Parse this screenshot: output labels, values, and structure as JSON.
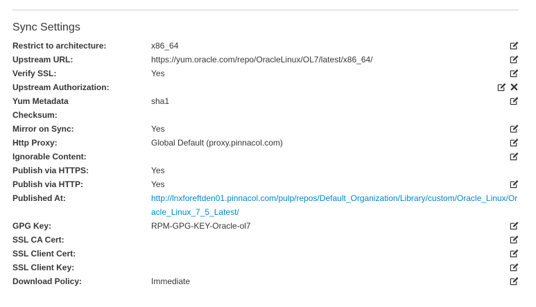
{
  "section": {
    "title": "Sync Settings"
  },
  "settings": [
    {
      "label": "Restrict to architecture:",
      "value": "x86_64",
      "edit": true,
      "clear": false
    },
    {
      "label": "Upstream URL:",
      "value": "https://yum.oracle.com/repo/OracleLinux/OL7/latest/x86_64/",
      "edit": true,
      "clear": false
    },
    {
      "label": "Verify SSL:",
      "value": "Yes",
      "edit": true,
      "clear": false
    },
    {
      "label": "Upstream Authorization:",
      "value": "",
      "edit": true,
      "clear": true
    },
    {
      "label": "Yum Metadata",
      "value": "sha1",
      "edit": true,
      "clear": false
    },
    {
      "label": "Checksum:",
      "value": "",
      "edit": false,
      "clear": false
    },
    {
      "label": "Mirror on Sync:",
      "value": "Yes",
      "edit": true,
      "clear": false
    },
    {
      "label": "Http Proxy:",
      "value": "Global Default (proxy.pinnacol.com)",
      "edit": true,
      "clear": false
    },
    {
      "label": "Ignorable Content:",
      "value": "",
      "edit": true,
      "clear": false
    },
    {
      "label": "Publish via HTTPS:",
      "value": "Yes",
      "edit": false,
      "clear": false
    },
    {
      "label": "Publish via HTTP:",
      "value": "Yes",
      "edit": true,
      "clear": false
    },
    {
      "label": "Published At:",
      "value": "http://lnxforeftden01.pinnacol.com/pulp/repos/Default_Organization/Library/custom/Oracle_Linux/Oracle_Linux_7_5_Latest/",
      "edit": false,
      "clear": false,
      "link": true
    },
    {
      "label": "GPG Key:",
      "value": "RPM-GPG-KEY-Oracle-ol7",
      "edit": true,
      "clear": false
    },
    {
      "label": "SSL CA Cert:",
      "value": "",
      "edit": true,
      "clear": false
    },
    {
      "label": "SSL Client Cert:",
      "value": "",
      "edit": true,
      "clear": false
    },
    {
      "label": "SSL Client Key:",
      "value": "",
      "edit": true,
      "clear": false
    },
    {
      "label": "Download Policy:",
      "value": "Immediate",
      "edit": true,
      "clear": false
    }
  ],
  "icons": {
    "edit": "edit-icon",
    "clear": "close-icon"
  },
  "colors": {
    "text": "#363636",
    "link": "#0088ce",
    "rule": "#d1d1d1"
  }
}
